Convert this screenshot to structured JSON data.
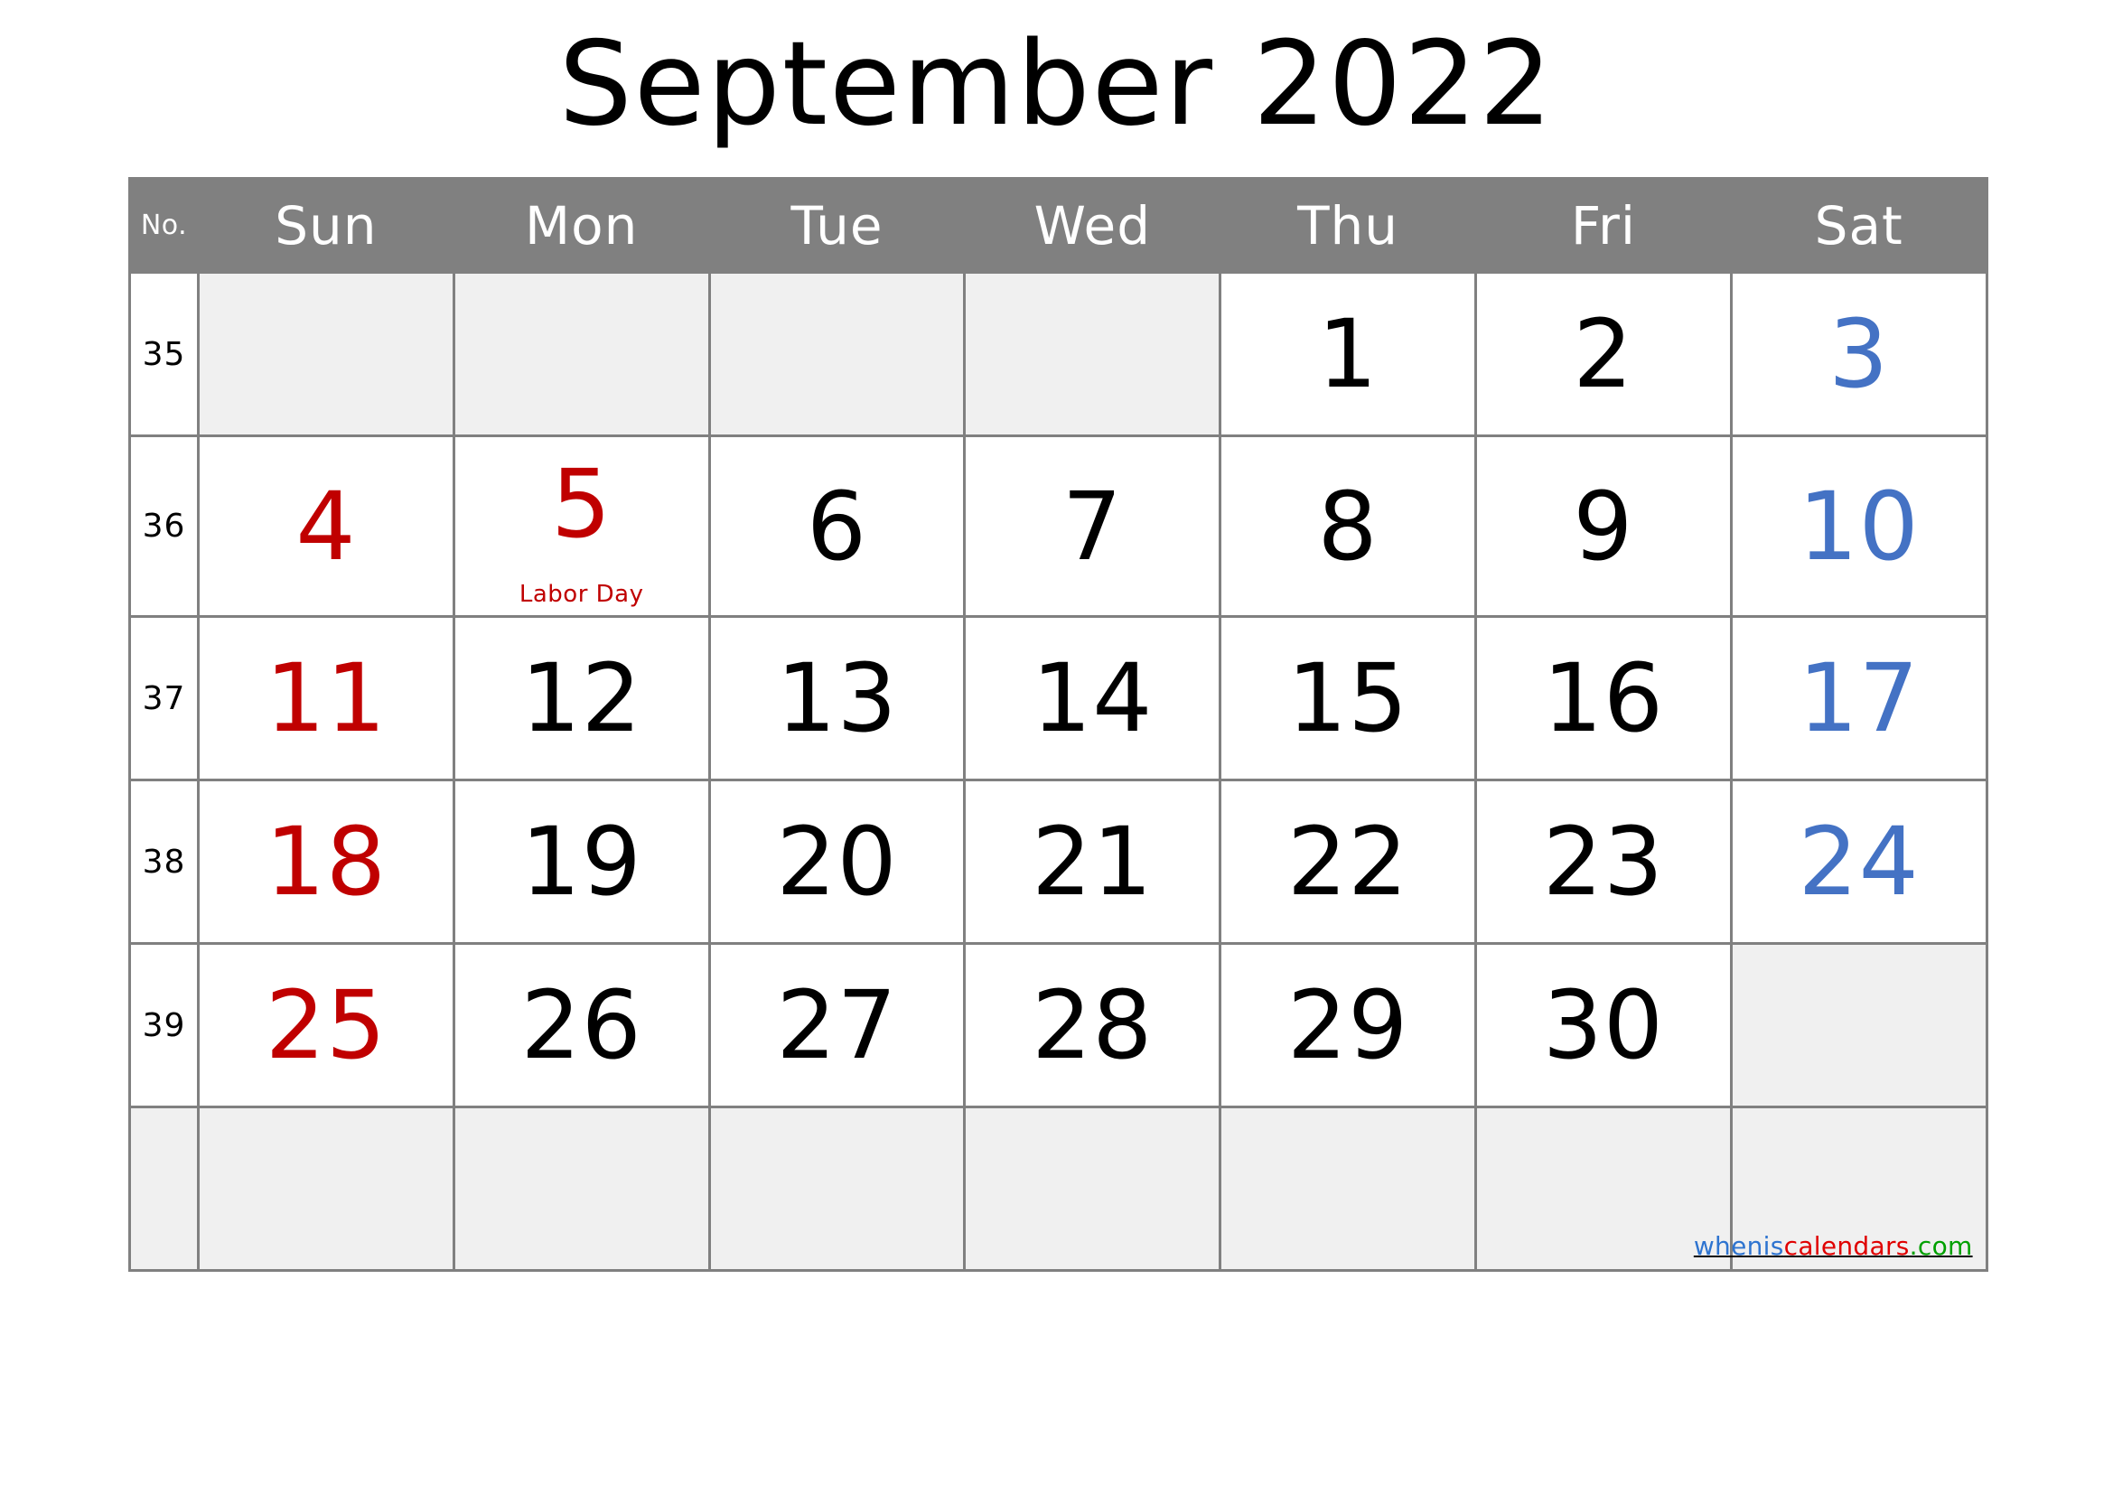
{
  "title": "September 2022",
  "colors": {
    "header_bg": "#808080",
    "header_text": "#ffffff",
    "border": "#808080",
    "empty_cell_bg": "#f0f0f0",
    "cell_bg": "#ffffff",
    "sunday": "#c00000",
    "saturday": "#4472c4",
    "weekday": "#000000",
    "event": "#c00000"
  },
  "header": {
    "week_no_label": "No.",
    "days": [
      "Sun",
      "Mon",
      "Tue",
      "Wed",
      "Thu",
      "Fri",
      "Sat"
    ]
  },
  "weeks": [
    {
      "number": "35",
      "days": [
        {
          "num": "",
          "type": "empty"
        },
        {
          "num": "",
          "type": "empty"
        },
        {
          "num": "",
          "type": "empty"
        },
        {
          "num": "",
          "type": "empty"
        },
        {
          "num": "1",
          "type": "weekday"
        },
        {
          "num": "2",
          "type": "weekday"
        },
        {
          "num": "3",
          "type": "sat"
        }
      ]
    },
    {
      "number": "36",
      "days": [
        {
          "num": "4",
          "type": "sun"
        },
        {
          "num": "5",
          "type": "sun",
          "event": "Labor Day"
        },
        {
          "num": "6",
          "type": "weekday"
        },
        {
          "num": "7",
          "type": "weekday"
        },
        {
          "num": "8",
          "type": "weekday"
        },
        {
          "num": "9",
          "type": "weekday"
        },
        {
          "num": "10",
          "type": "sat"
        }
      ]
    },
    {
      "number": "37",
      "days": [
        {
          "num": "11",
          "type": "sun"
        },
        {
          "num": "12",
          "type": "weekday"
        },
        {
          "num": "13",
          "type": "weekday"
        },
        {
          "num": "14",
          "type": "weekday"
        },
        {
          "num": "15",
          "type": "weekday"
        },
        {
          "num": "16",
          "type": "weekday"
        },
        {
          "num": "17",
          "type": "sat"
        }
      ]
    },
    {
      "number": "38",
      "days": [
        {
          "num": "18",
          "type": "sun"
        },
        {
          "num": "19",
          "type": "weekday"
        },
        {
          "num": "20",
          "type": "weekday"
        },
        {
          "num": "21",
          "type": "weekday"
        },
        {
          "num": "22",
          "type": "weekday"
        },
        {
          "num": "23",
          "type": "weekday"
        },
        {
          "num": "24",
          "type": "sat"
        }
      ]
    },
    {
      "number": "39",
      "days": [
        {
          "num": "25",
          "type": "sun"
        },
        {
          "num": "26",
          "type": "weekday"
        },
        {
          "num": "27",
          "type": "weekday"
        },
        {
          "num": "28",
          "type": "weekday"
        },
        {
          "num": "29",
          "type": "weekday"
        },
        {
          "num": "30",
          "type": "weekday"
        },
        {
          "num": "",
          "type": "empty"
        }
      ]
    },
    {
      "number": "",
      "days": [
        {
          "num": "",
          "type": "empty"
        },
        {
          "num": "",
          "type": "empty"
        },
        {
          "num": "",
          "type": "empty"
        },
        {
          "num": "",
          "type": "empty"
        },
        {
          "num": "",
          "type": "empty"
        },
        {
          "num": "",
          "type": "empty"
        },
        {
          "num": "",
          "type": "empty",
          "watermark": true
        }
      ]
    }
  ],
  "watermark": {
    "part1": "whenis",
    "part2": "calendars",
    "part3": ".com"
  }
}
